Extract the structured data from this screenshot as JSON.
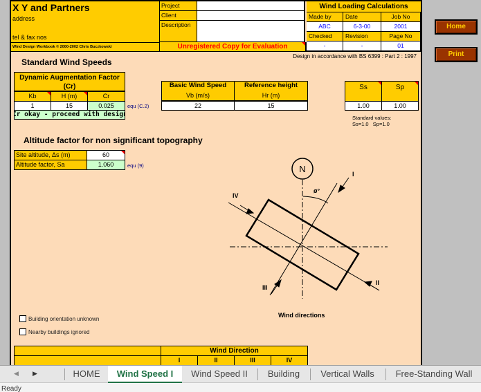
{
  "header": {
    "company": "X Y and Partners",
    "address": "address",
    "telfax": "tel & fax nos",
    "workbook": "Wind Design Workbook © 2000-2002 Chris Buczkowski",
    "project_label": "Project",
    "client_label": "Client",
    "description_label": "Description",
    "project_value": "",
    "client_value": "",
    "description_value": "",
    "unregistered": "Unregistered Copy for Evaluation",
    "calc_title": "Wind Loading Calculations",
    "made_by_label": "Made by",
    "date_label": "Date",
    "job_no_label": "Job No",
    "made_by": "ABC",
    "date": "6-3-00",
    "job_no": "2001",
    "checked_label": "Checked",
    "revision_label": "Revision",
    "page_no_label": "Page No",
    "checked": "-",
    "revision": "-",
    "page_no": "01",
    "standard": "Design in accordance with BS 6399 : Part 2 : 1997"
  },
  "buttons": {
    "home": "Home",
    "print": "Print"
  },
  "standard_wind": {
    "title": "Standard Wind Speeds",
    "dyn_title": "Dynamic Augmentation Factor (Cr)",
    "kb_label": "Kb",
    "h_label": "H (m)",
    "cr_label": "Cr",
    "kb": "1",
    "h": "15",
    "cr": "0.025",
    "equ": "equ (C.2)",
    "status": "Cr okay - proceed with design",
    "vb_title": "Basic Wind Speed",
    "vb_label": "Vb (m/s)",
    "vb": "22",
    "hr_title": "Reference height",
    "hr_label": "Hr (m)",
    "hr": "15",
    "ss_label": "Ss",
    "sp_label": "Sp",
    "ss": "1.00",
    "sp": "1.00",
    "std_values_1": "Standard values:",
    "std_values_2": "Ss=1.0   Sp=1.0"
  },
  "altitude": {
    "title": "Altitude factor for non significant topography",
    "site_label": "Site altitude, Δs (m)",
    "site_value": "60",
    "factor_label": "Altitude factor, Sa",
    "factor_value": "1.060",
    "equ": "equ (9)"
  },
  "diagram": {
    "north": "N",
    "angle": "ø°",
    "dir1": "I",
    "dir2": "II",
    "dir3": "III",
    "dir4": "IV",
    "caption": "Wind directions"
  },
  "checkboxes": [
    {
      "label": "Building orientation unknown",
      "checked": false
    },
    {
      "label": "Nearby buildings ignored",
      "checked": false
    }
  ],
  "wind_direction_table": {
    "title": "Wind Direction",
    "columns": [
      "I",
      "II",
      "III",
      "IV"
    ]
  },
  "tabs": [
    {
      "label": "HOME",
      "active": false
    },
    {
      "label": "Wind Speed I",
      "active": true
    },
    {
      "label": "Wind Speed II",
      "active": false
    },
    {
      "label": "Building",
      "active": false
    },
    {
      "label": "Vertical Walls",
      "active": false
    },
    {
      "label": "Free-Standing Wall",
      "active": false
    }
  ],
  "status": "Ready"
}
